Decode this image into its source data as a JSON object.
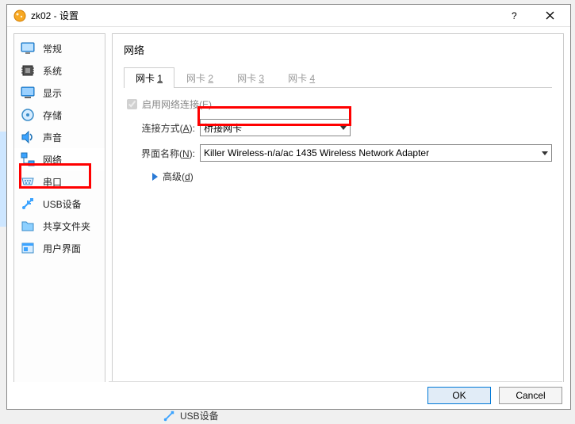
{
  "titlebar": {
    "title": "zk02 - 设置"
  },
  "sidebar": {
    "items": [
      {
        "label": "常规"
      },
      {
        "label": "系统"
      },
      {
        "label": "显示"
      },
      {
        "label": "存储"
      },
      {
        "label": "声音"
      },
      {
        "label": "网络"
      },
      {
        "label": "串口"
      },
      {
        "label": "USB设备"
      },
      {
        "label": "共享文件夹"
      },
      {
        "label": "用户界面"
      }
    ]
  },
  "main": {
    "title": "网络",
    "tabs": [
      {
        "prefix": "网卡 ",
        "num": "1"
      },
      {
        "prefix": "网卡 ",
        "num": "2"
      },
      {
        "prefix": "网卡 ",
        "num": "3"
      },
      {
        "prefix": "网卡 ",
        "num": "4"
      }
    ],
    "enable_label": "启用网络连接(E)",
    "attach_label_pre": "连接方式(",
    "attach_label_key": "A",
    "attach_label_post": "):",
    "attach_value": "桥接网卡",
    "name_label_pre": "界面名称(",
    "name_label_key": "N",
    "name_label_post": "):",
    "name_value": "Killer Wireless-n/a/ac 1435 Wireless Network Adapter",
    "advanced_pre": "高级(",
    "advanced_key": "d",
    "advanced_post": ")"
  },
  "footer": {
    "ok": "OK",
    "cancel": "Cancel"
  },
  "below": {
    "label": "USB设备"
  }
}
